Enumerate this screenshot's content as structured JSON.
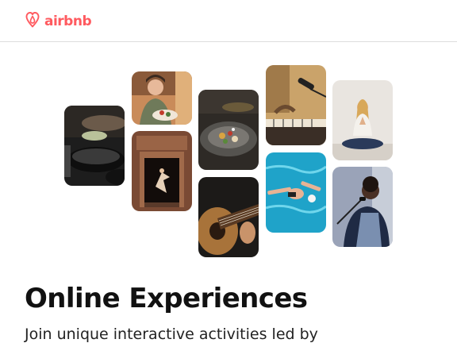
{
  "header": {
    "logo_text": "airbnb",
    "logo_icon": "airbnb-belo-icon",
    "brand_color": "#ff5a5f"
  },
  "collage": {
    "tiles": [
      {
        "id": "cooking",
        "subject": "cooking-pans-photo"
      },
      {
        "id": "woman-with-food",
        "subject": "woman-holding-food-photo"
      },
      {
        "id": "dancer-doorway",
        "subject": "dancer-in-doorway-photo"
      },
      {
        "id": "plated-dish",
        "subject": "plated-dish-photo"
      },
      {
        "id": "guitar",
        "subject": "acoustic-guitar-photo"
      },
      {
        "id": "keyboard-microphone",
        "subject": "keyboard-and-microphone-photo"
      },
      {
        "id": "swimmer",
        "subject": "swimmer-in-pool-photo"
      },
      {
        "id": "meditation",
        "subject": "woman-meditating-photo"
      },
      {
        "id": "singer",
        "subject": "singer-with-microphone-photo"
      }
    ]
  },
  "main": {
    "title": "Online Experiences",
    "subtitle": "Join unique interactive activities led by"
  }
}
